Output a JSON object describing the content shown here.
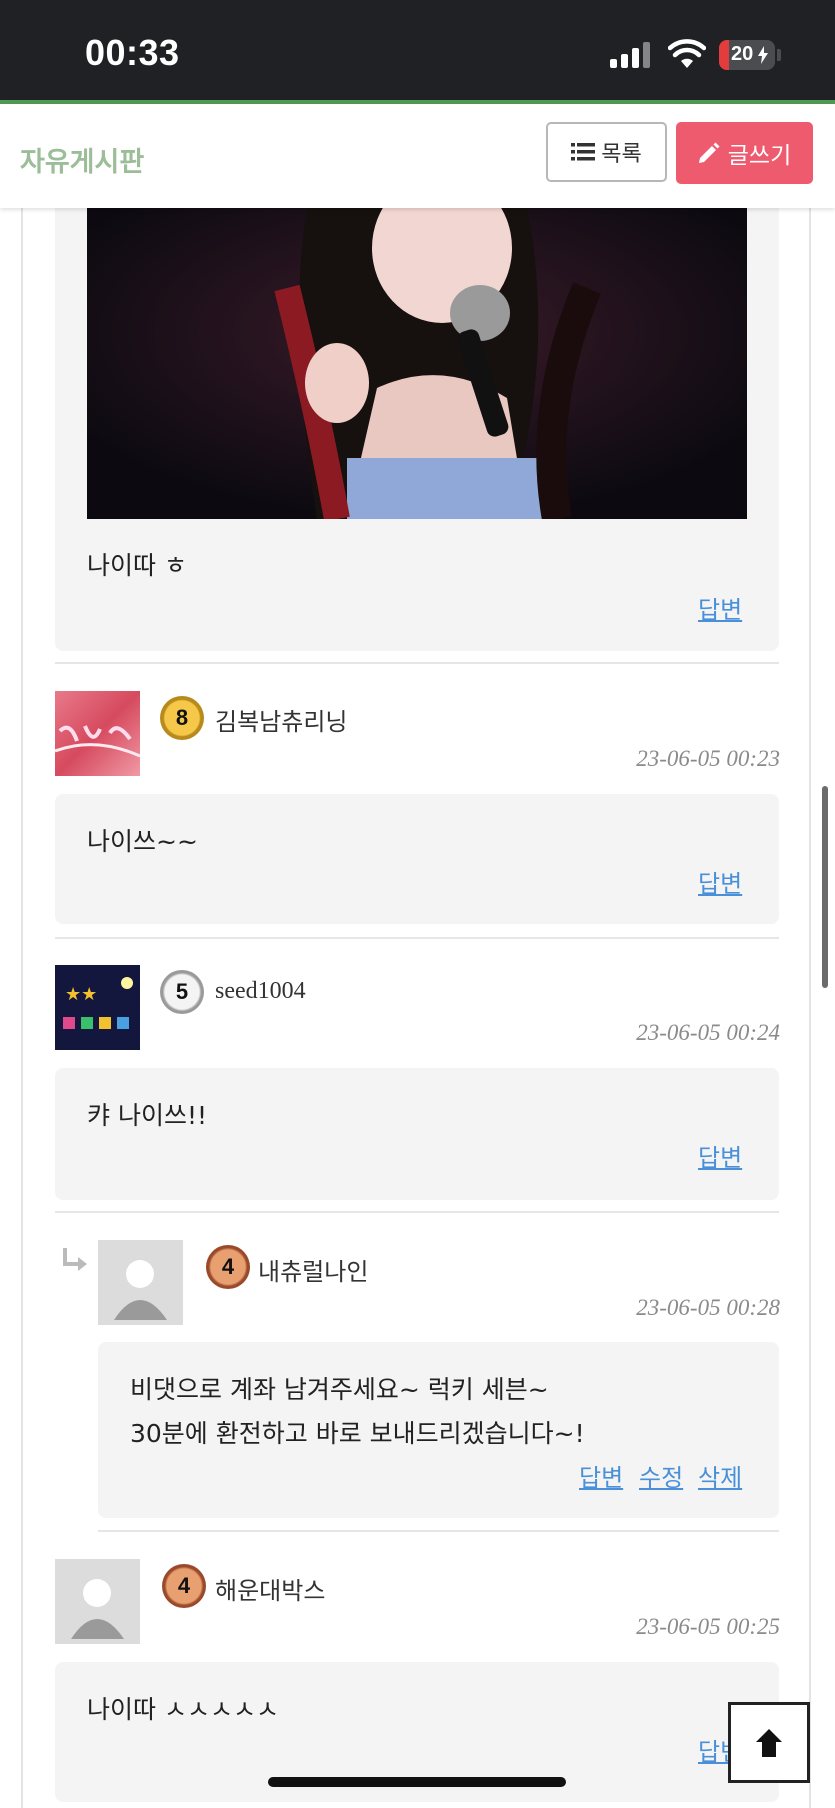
{
  "status_bar": {
    "time": "00:33",
    "battery": "20"
  },
  "header": {
    "board_title": "자유게시판",
    "list_button": "목록",
    "write_button": "글쓰기"
  },
  "first_comment": {
    "text": "나이따 ㅎ",
    "reply_label": "답변"
  },
  "comments": [
    {
      "username": "김복남츄리닝",
      "level": "8",
      "date": "23-06-05 00:23",
      "text": "나이쓰~~",
      "reply_label": "답변"
    },
    {
      "username": "seed1004",
      "level": "5",
      "date": "23-06-05 00:24",
      "text": "캬 나이쓰!!",
      "reply_label": "답변"
    },
    {
      "username": "내츄럴나인",
      "level": "4",
      "date": "23-06-05 00:28",
      "text_line1": "비댓으로 계좌 남겨주세요~ 럭키 세븐~",
      "text_line2": "30분에 환전하고 바로 보내드리겠습니다~!",
      "reply_label": "답변",
      "edit_label": "수정",
      "delete_label": "삭제"
    },
    {
      "username": "해운대박스",
      "level": "4",
      "date": "23-06-05 00:25",
      "text": "나이따 ㅅㅅㅅㅅㅅ",
      "reply_label": "답변"
    }
  ],
  "colors": {
    "accent_green": "#9bbe99",
    "write_button": "#ef5b6e",
    "link_blue": "#4a90d9",
    "status_bar": "#1f2124"
  },
  "icons": [
    "list-icon",
    "pencil-icon",
    "reply-arrow-icon",
    "arrow-up-icon"
  ]
}
